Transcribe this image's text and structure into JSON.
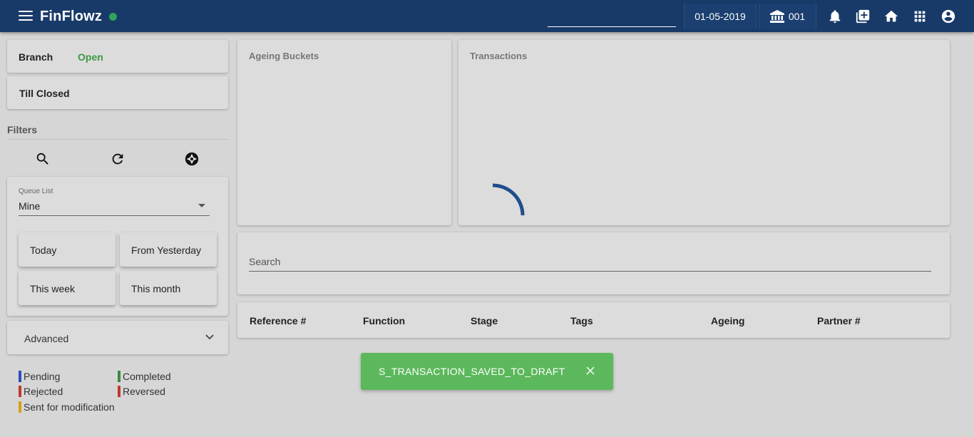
{
  "header": {
    "app_name": "FinFlowz",
    "date": "01-05-2019",
    "branch_code": "001",
    "status_color": "#2fa35a",
    "icons": [
      "menu-icon",
      "bank-icon",
      "bell-icon",
      "add-box-icon",
      "home-icon",
      "apps-grid-icon",
      "account-circle-icon"
    ]
  },
  "sidebar": {
    "branch_label": "Branch",
    "branch_status": "Open",
    "till_label": "Till Closed",
    "filters_title": "Filters",
    "filter_icons": [
      "search-icon",
      "refresh-icon",
      "aperture-icon"
    ],
    "queue_label": "Queue List",
    "queue_value": "Mine",
    "periods": [
      "Today",
      "From Yesterday",
      "This week",
      "This month"
    ],
    "advanced_label": "Advanced"
  },
  "legend": [
    {
      "label": "Pending",
      "color": "#2a4fb8"
    },
    {
      "label": "Completed",
      "color": "#3a8a3e"
    },
    {
      "label": "Rejected",
      "color": "#c0392b"
    },
    {
      "label": "Reversed",
      "color": "#c0392b"
    },
    {
      "label": "Sent for modification",
      "color": "#d4a017"
    }
  ],
  "main": {
    "ageing_title": "Ageing Buckets",
    "transactions_title": "Transactions",
    "search_placeholder": "Search",
    "columns": [
      "Reference #",
      "Function",
      "Stage",
      "Tags",
      "Ageing",
      "Partner #"
    ]
  },
  "toast": {
    "message": "S_TRANSACTION_SAVED_TO_DRAFT",
    "color": "#5cb85c"
  }
}
